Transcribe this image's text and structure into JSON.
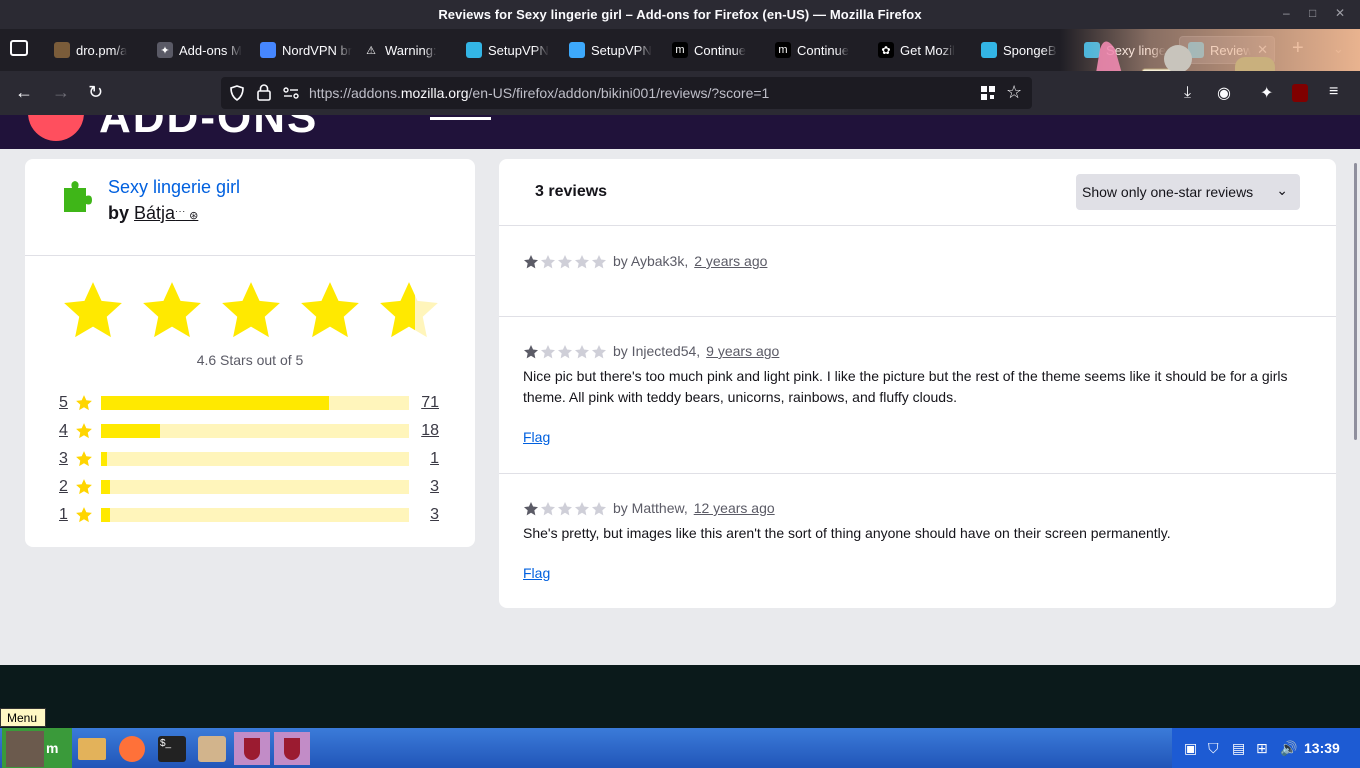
{
  "window": {
    "title": "Reviews for Sexy lingerie girl – Add-ons for Firefox (en-US) — Mozilla Firefox",
    "controls": [
      "–",
      "□",
      "✕"
    ]
  },
  "tabs": [
    {
      "label": "dro.pm/a",
      "icon": "page-icon"
    },
    {
      "label": "Add-ons M",
      "icon": "puzzle-icon"
    },
    {
      "label": "NordVPN bro",
      "icon": "nordvpn-icon"
    },
    {
      "label": "Warning:",
      "icon": "warning-icon"
    },
    {
      "label": "SetupVPN",
      "icon": "setupvpn-icon"
    },
    {
      "label": "SetupVPN",
      "icon": "globe-icon"
    },
    {
      "label": "Continue",
      "icon": "m-icon"
    },
    {
      "label": "Continue",
      "icon": "m-icon"
    },
    {
      "label": "Get Mozil",
      "icon": "mozilla-icon"
    },
    {
      "label": "SpongeB",
      "icon": "theme-icon"
    },
    {
      "label": "Sexy linge",
      "icon": "theme-icon"
    },
    {
      "label": "Review",
      "icon": "theme-icon",
      "active": true
    }
  ],
  "new_tab_label": "+",
  "url": {
    "prefix": "https://addons.",
    "domain": "mozilla.org",
    "path": "/en-US/firefox/addon/bikini001/reviews/?score=1"
  },
  "addon": {
    "name": "Sexy lingerie girl",
    "by_label": "by",
    "author": "Bátja",
    "author_suffix": "˙˙˙ ⊛",
    "average_label": "4.6 Stars out of 5",
    "average": 4.6,
    "distribution": [
      {
        "stars": "5",
        "count": "71",
        "fraction": 0.74
      },
      {
        "stars": "4",
        "count": "18",
        "fraction": 0.19
      },
      {
        "stars": "3",
        "count": "1",
        "fraction": 0.01
      },
      {
        "stars": "2",
        "count": "3",
        "fraction": 0.03
      },
      {
        "stars": "1",
        "count": "3",
        "fraction": 0.03
      }
    ]
  },
  "reviews": {
    "header": "3 reviews",
    "filter_label": "Show only one-star reviews",
    "items": [
      {
        "rating": 1,
        "by": "by Aybak3k,",
        "date": "2 years ago",
        "body": "",
        "flag": ""
      },
      {
        "rating": 1,
        "by": "by Injected54,",
        "date": "9 years ago",
        "body": "Nice pic but there's too much pink and light pink. I like the picture but the rest of the theme seems like it should be for a girls theme. All pink with teddy bears, unicorns, rainbows, and fluffy clouds.",
        "flag": "Flag"
      },
      {
        "rating": 1,
        "by": "by Matthew,",
        "date": "12 years ago",
        "body": "She's pretty, but images like this aren't the sort of thing anyone should have on their screen permanently.",
        "flag": "Flag"
      }
    ]
  },
  "hero": {
    "logo_text": "ADD-ONS"
  },
  "taskbar": {
    "tooltip": "Menu",
    "clock": "13:39"
  },
  "colors": {
    "accent": "#0060df",
    "star": "#ffe900",
    "star_empty": "#fff5bb"
  }
}
